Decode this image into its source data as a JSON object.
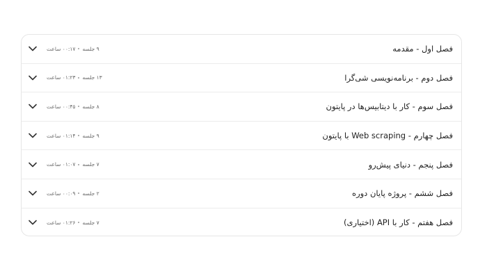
{
  "chapters": [
    {
      "title": "فصل اول - مقدمه",
      "sessions": "۹ جلسه",
      "duration": "۰۰:۱۷ ساعت"
    },
    {
      "title": "فصل دوم - برنامه‌نویسی شی‌گرا",
      "sessions": "۱۳ جلسه",
      "duration": "۰۱:۲۳ ساعت"
    },
    {
      "title": "فصل سوم - کار با دیتابیس‌ها در پایتون",
      "sessions": "۸ جلسه",
      "duration": "۰۰:۴۵ ساعت"
    },
    {
      "title": "فصل چهارم - Web scraping با پایتون",
      "sessions": "۹ جلسه",
      "duration": "۰۱:۱۴ ساعت"
    },
    {
      "title": "فصل پنجم - دنیای پیش‌رو",
      "sessions": "۷ جلسه",
      "duration": "۰۱:۰۷ ساعت"
    },
    {
      "title": "فصل ششم - پروژه پایان دوره",
      "sessions": "۲ جلسه",
      "duration": "۰۰:۰۹ ساعت"
    },
    {
      "title": "فصل هفتم - کار با API (اختیاری)",
      "sessions": "۷ جلسه",
      "duration": "۰۱:۲۶ ساعت"
    }
  ],
  "icons": {
    "expand": "chevron-down-icon"
  }
}
